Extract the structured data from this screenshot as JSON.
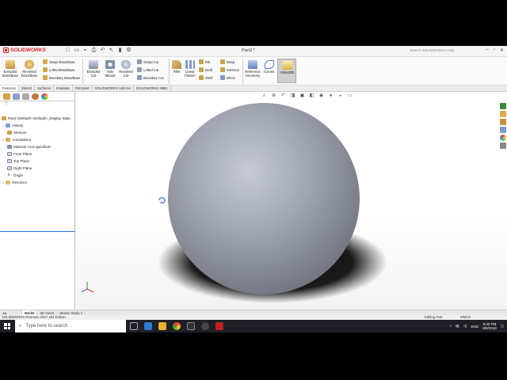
{
  "titlebar": {
    "brand": "SOLIDWORKS",
    "document_title": "Part2 *",
    "search_placeholder": "Search SOLIDWORKS Help",
    "quick_access_icons": [
      "new-icon",
      "open-icon",
      "save-icon",
      "print-icon",
      "undo-icon",
      "select-icon",
      "rebuild-icon",
      "options-icon"
    ]
  },
  "command_manager": {
    "extruded_boss": "Extruded Boss/Base",
    "revolved_boss": "Revolved Boss/Base",
    "swept_boss": "Swept Boss/Base",
    "lofted_boss": "Lofted Boss/Base",
    "boundary_boss": "Boundary Boss/Base",
    "extruded_cut": "Extruded Cut",
    "hole_wizard": "Hole Wizard",
    "revolved_cut": "Revolved Cut",
    "swept_cut": "Swept Cut",
    "lofted_cut": "Lofted Cut",
    "boundary_cut": "Boundary Cut",
    "fillet": "Fillet",
    "linear_pattern": "Linear Pattern",
    "rib": "Rib",
    "draft": "Draft",
    "shell": "Shell",
    "wrap": "Wrap",
    "intersect": "Intersect",
    "mirror": "Mirror",
    "reference_geometry": "Reference Geometry",
    "curves": "Curves",
    "instant3d": "Instant3D"
  },
  "tabs": [
    "Features",
    "Sketch",
    "Surfaces",
    "Evaluate",
    "DimXpert",
    "SOLIDWORKS Add-Ins",
    "SOLIDWORKS MBD"
  ],
  "feature_tree": {
    "root": "Part2  (Default<<Default>_Display State",
    "items": [
      "History",
      "Sensors",
      "Annotations",
      "Material <not specified>",
      "Front Plane",
      "Top Plane",
      "Right Plane",
      "Origin",
      "Revolve1"
    ]
  },
  "model_tabs": [
    "Model",
    "3D Views",
    "Motion Study 1"
  ],
  "status": {
    "left_text": "SOLIDWORKS Premium 2017 x64 Edition",
    "mode": "Editing Part",
    "units": "MMGS"
  },
  "taskbar": {
    "search_placeholder": "Type here to search",
    "language": "ENG",
    "time": "9:00 PM",
    "date": "8/9/2019"
  },
  "colors": {
    "accent": "#2a6fd6",
    "brand_red": "#d22020",
    "sphere": "#9a9eaa",
    "taskbar": "#1f1f25"
  }
}
